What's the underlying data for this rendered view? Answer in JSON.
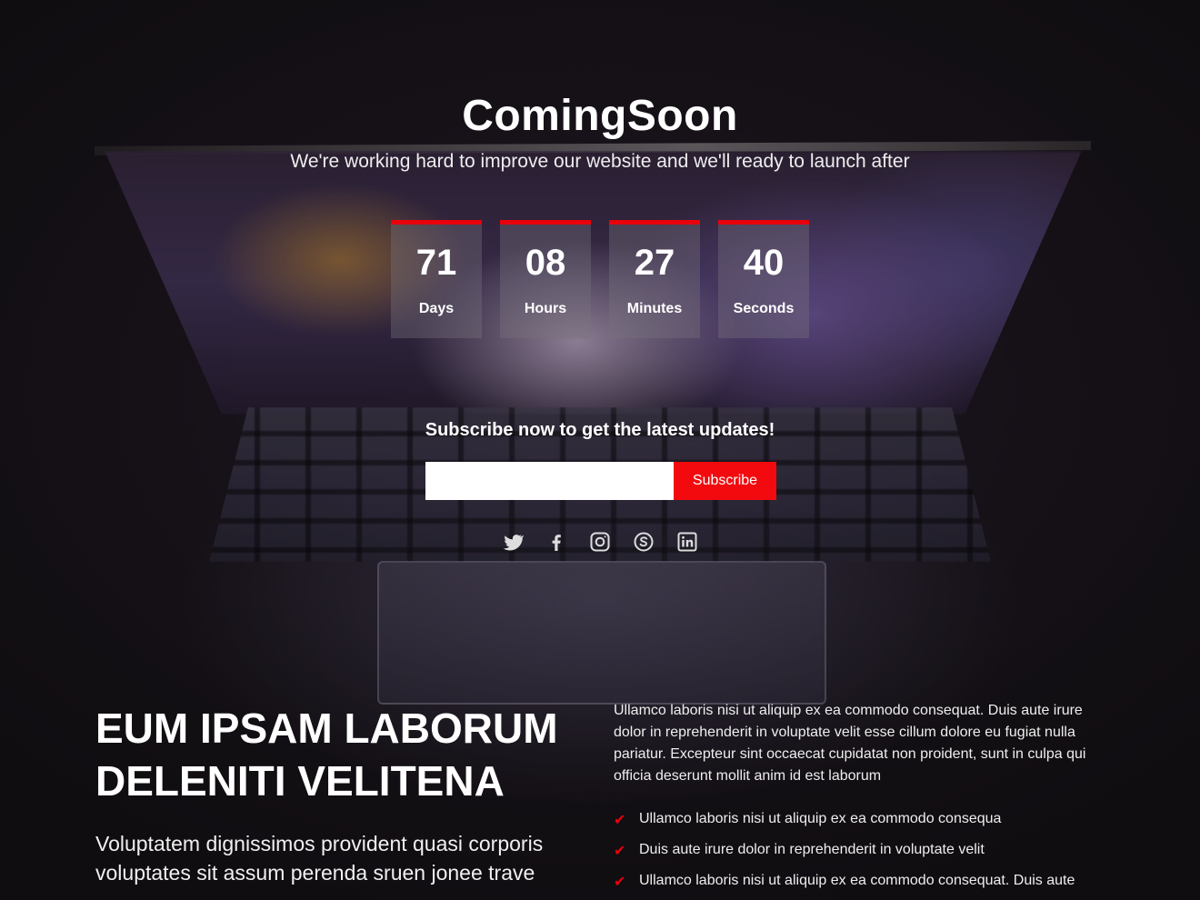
{
  "header": {
    "title": "ComingSoon",
    "subtitle": "We're working hard to improve our website and we'll ready to launch after"
  },
  "countdown": [
    {
      "value": "71",
      "label": "Days"
    },
    {
      "value": "08",
      "label": "Hours"
    },
    {
      "value": "27",
      "label": "Minutes"
    },
    {
      "value": "40",
      "label": "Seconds"
    }
  ],
  "subscribe": {
    "heading": "Subscribe now to get the latest updates!",
    "input_value": "",
    "button_label": "Subscribe"
  },
  "social": [
    "twitter-icon",
    "facebook-icon",
    "instagram-icon",
    "skype-icon",
    "linkedin-icon"
  ],
  "about": {
    "heading_line1": "EUM IPSAM LABORUM",
    "heading_line2": "DELENITI VELITENA",
    "lead": "Voluptatem dignissimos provident quasi corporis voluptates sit assum perenda sruen jonee trave",
    "paragraph": "Ullamco laboris nisi ut aliquip ex ea commodo consequat. Duis aute irure dolor in reprehenderit in voluptate velit esse cillum dolore eu fugiat nulla pariatur. Excepteur sint occaecat cupidatat non proident, sunt in culpa qui officia deserunt mollit anim id est laborum",
    "list": [
      "Ullamco laboris nisi ut aliquip ex ea commodo consequa",
      "Duis aute irure dolor in reprehenderit in voluptate velit",
      "Ullamco laboris nisi ut aliquip ex ea commodo consequat. Duis aute"
    ]
  },
  "colors": {
    "accent": "#e8000b",
    "button": "#f20a0f",
    "background": "#141214"
  }
}
